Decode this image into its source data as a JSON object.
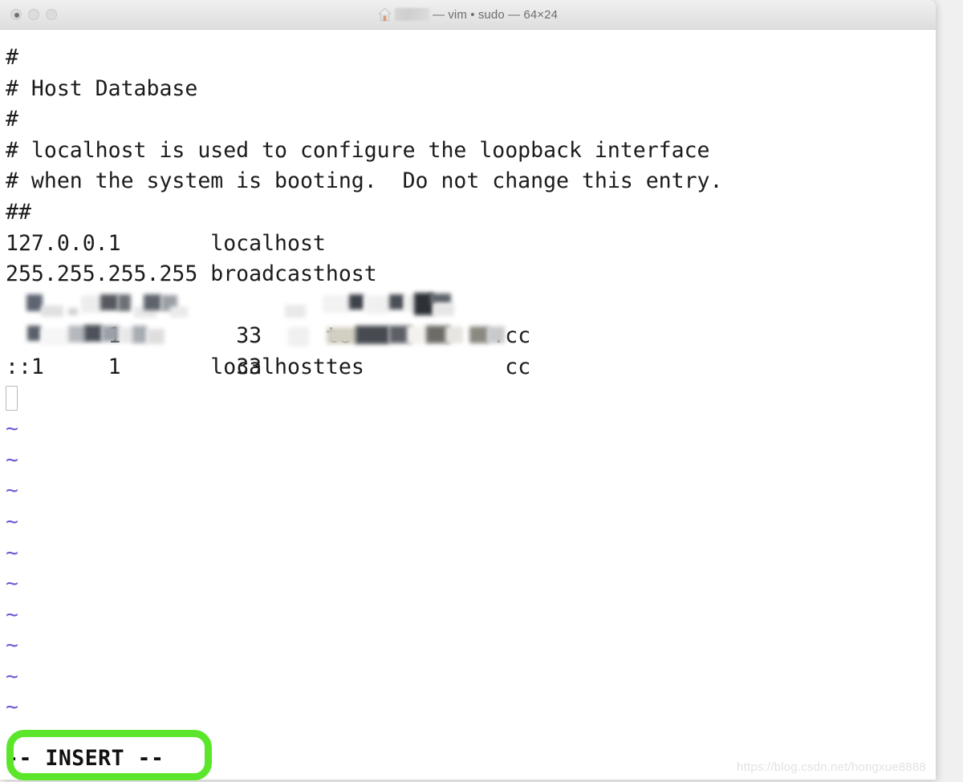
{
  "window": {
    "title_prefix_icon": "home-icon",
    "title_redacted": "",
    "title_text": "— vim • sudo — 64×24",
    "traffic_lights": [
      "close",
      "minimize",
      "zoom"
    ]
  },
  "editor": {
    "lines": [
      "#",
      "# Host Database",
      "#",
      "# localhost is used to configure the loopback interface",
      "# when the system is booting.  Do not change this entry.",
      "##",
      "127.0.0.1       localhost",
      "255.255.255.255 broadcasthost"
    ],
    "redacted_rows": [
      {
        "ip_prefix": "1",
        "ip_suffix": "33",
        "host_prefix": "te",
        "host_suffix": ".cc"
      },
      {
        "ip_prefix": "1",
        "ip_suffix": "33",
        "host_prefix": "tes",
        "host_suffix": "cc"
      }
    ],
    "ipv6_line": "::1             localhost",
    "empty_marker": "~",
    "empty_marker_count": 10,
    "cursor": "block-cursor"
  },
  "status": {
    "mode_text": "-- INSERT --"
  },
  "annotation": {
    "highlight_color": "#5ce62b",
    "target": "insert-mode-indicator"
  },
  "watermark": {
    "text": "https://blog.csdn.net/hongxue8888"
  }
}
